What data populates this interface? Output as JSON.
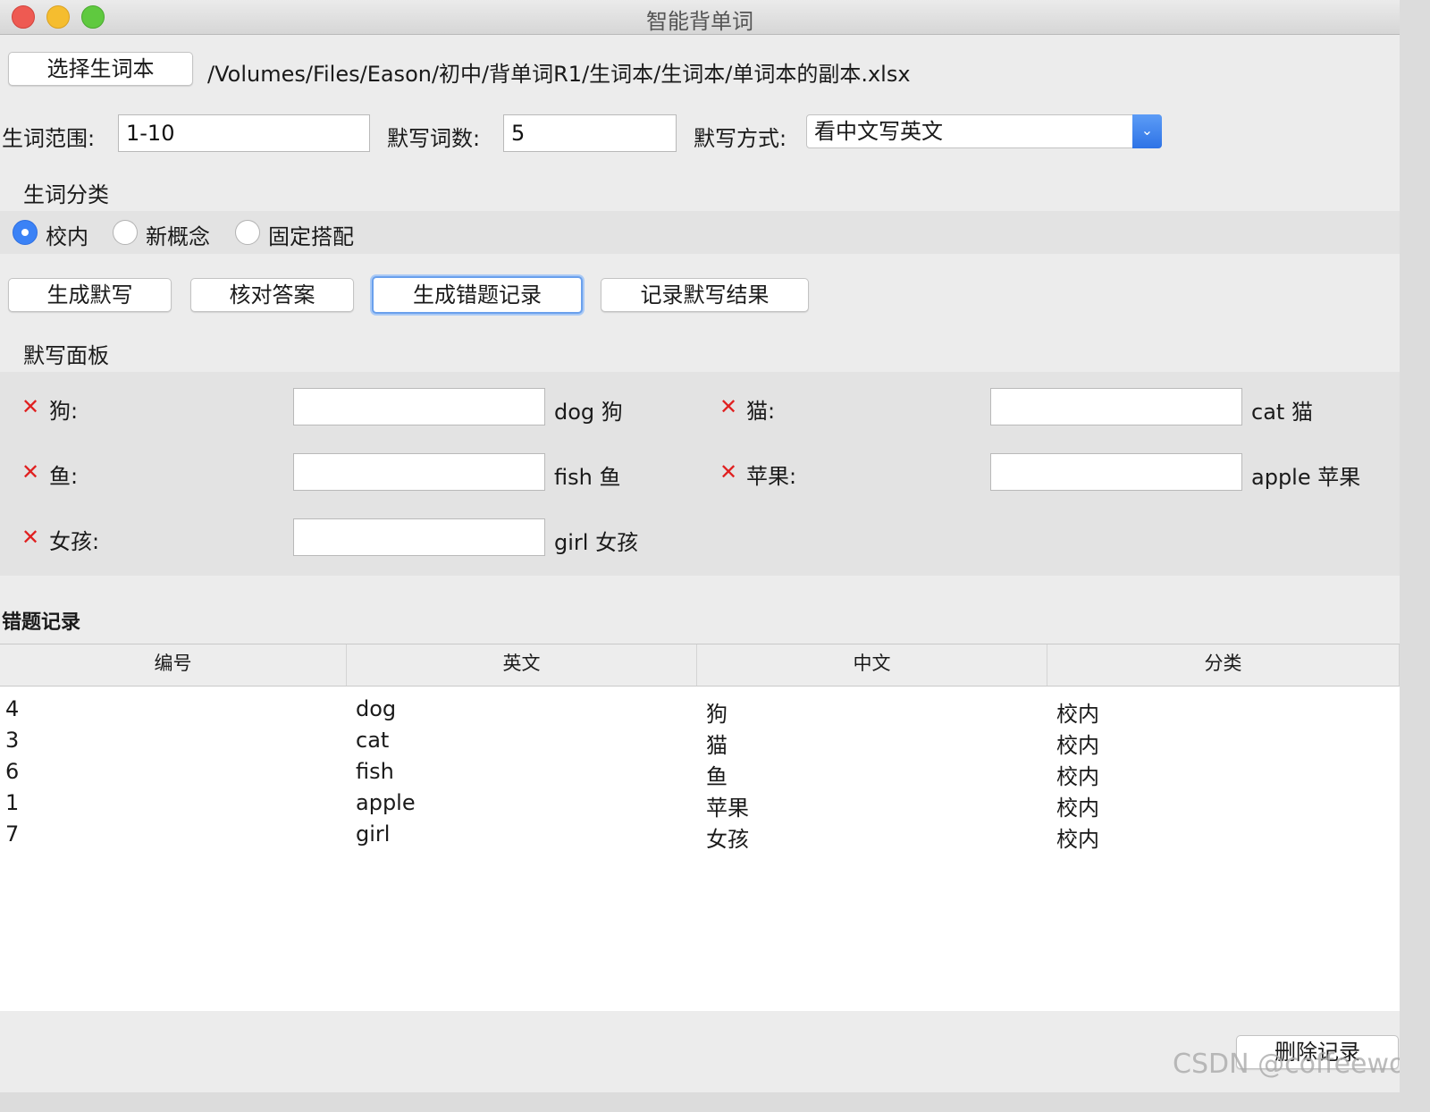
{
  "window": {
    "title": "智能背单词"
  },
  "file": {
    "choose_label": "选择生词本",
    "path": "/Volumes/Files/Eason/初中/背单词R1/生词本/生词本/单词本的副本.xlsx"
  },
  "settings": {
    "range_label": "生词范围:",
    "range_value": "1-10",
    "count_label": "默写词数:",
    "count_value": "5",
    "mode_label": "默写方式:",
    "mode_value": "看中文写英文"
  },
  "category": {
    "title": "生词分类",
    "options": [
      {
        "label": "校内",
        "checked": true
      },
      {
        "label": "新概念",
        "checked": false
      },
      {
        "label": "固定搭配",
        "checked": false
      }
    ]
  },
  "actions": {
    "generate": "生成默写",
    "check": "核对答案",
    "make_errors": "生成错题记录",
    "record": "记录默写结果"
  },
  "dictation": {
    "title": "默写面板",
    "items": [
      {
        "prompt": "狗:",
        "input": "",
        "answer": "dog 狗",
        "status_icon": "x-mark-icon"
      },
      {
        "prompt": "猫:",
        "input": "",
        "answer": "cat 猫",
        "status_icon": "x-mark-icon"
      },
      {
        "prompt": "鱼:",
        "input": "",
        "answer": "fish 鱼",
        "status_icon": "x-mark-icon"
      },
      {
        "prompt": "苹果:",
        "input": "",
        "answer": "apple 苹果",
        "status_icon": "x-mark-icon"
      },
      {
        "prompt": "女孩:",
        "input": "",
        "answer": "girl 女孩",
        "status_icon": "x-mark-icon"
      }
    ],
    "x_mark": "✕"
  },
  "errors": {
    "title": "错题记录",
    "columns": [
      "编号",
      "英文",
      "中文",
      "分类"
    ],
    "rows": [
      [
        "4",
        "dog",
        "狗",
        "校内"
      ],
      [
        "3",
        "cat",
        "猫",
        "校内"
      ],
      [
        "6",
        "fish",
        "鱼",
        "校内"
      ],
      [
        "1",
        "apple",
        "苹果",
        "校内"
      ],
      [
        "7",
        "girl",
        "女孩",
        "校内"
      ]
    ],
    "delete_label": "删除记录"
  },
  "watermark": "CSDN @coffeewoo",
  "colors": {
    "accent": "#3b82f6",
    "wrong": "#e02020"
  }
}
